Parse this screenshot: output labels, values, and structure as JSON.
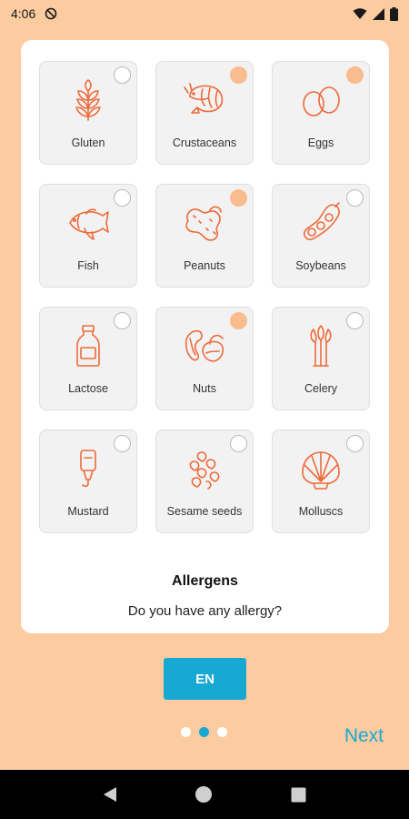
{
  "status": {
    "time": "4:06"
  },
  "allergens": [
    {
      "label": "Gluten",
      "icon": "wheat-icon",
      "selected": false
    },
    {
      "label": "Crustaceans",
      "icon": "shrimp-icon",
      "selected": true
    },
    {
      "label": "Eggs",
      "icon": "eggs-icon",
      "selected": true
    },
    {
      "label": "Fish",
      "icon": "fish-icon",
      "selected": false
    },
    {
      "label": "Peanuts",
      "icon": "peanut-icon",
      "selected": true
    },
    {
      "label": "Soybeans",
      "icon": "soybean-icon",
      "selected": false
    },
    {
      "label": "Lactose",
      "icon": "milk-bottle-icon",
      "selected": false
    },
    {
      "label": "Nuts",
      "icon": "nuts-icon",
      "selected": true
    },
    {
      "label": "Celery",
      "icon": "celery-icon",
      "selected": false
    },
    {
      "label": "Mustard",
      "icon": "mustard-bottle-icon",
      "selected": false
    },
    {
      "label": "Sesame seeds",
      "icon": "sesame-icon",
      "selected": false
    },
    {
      "label": "Molluscs",
      "icon": "shell-icon",
      "selected": false
    }
  ],
  "card": {
    "title": "Allergens",
    "subtitle": "Do you have any allergy?"
  },
  "language_button": "EN",
  "pager": {
    "count": 3,
    "active_index": 1
  },
  "next_label": "Next",
  "colors": {
    "background": "#FDCBA0",
    "accent": "#17A9D3",
    "icon_stroke": "#EE6A3A",
    "selected_check": "#F9BC8E"
  }
}
